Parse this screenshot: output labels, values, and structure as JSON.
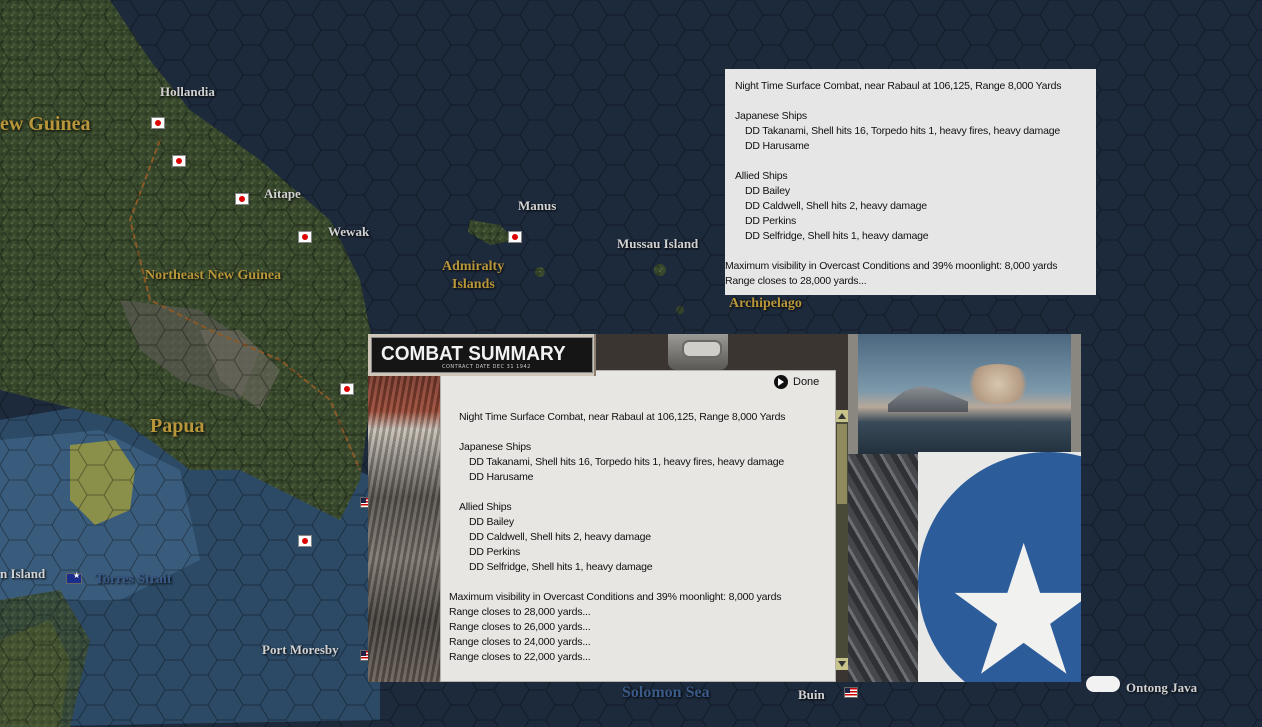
{
  "map": {
    "town_labels": [
      "Hollandia",
      "Aitape",
      "Wewak",
      "Manus",
      "Mussau Island",
      "Port Moresby",
      "Buin",
      "Ontong Java",
      "n Island"
    ],
    "region_labels": [
      "ew Guinea",
      "Northeast New Guinea",
      "Papua",
      "Admiralty",
      "Islands",
      "Archipelago",
      "Torres Strait",
      "Solomon Sea"
    ]
  },
  "tooltip": {
    "title": "Night Time Surface Combat, near Rabaul at 106,125, Range 8,000 Yards",
    "japanese_header": "Japanese Ships",
    "japanese_ships": [
      "DD Takanami, Shell hits 16, Torpedo hits 1,  heavy fires,  heavy damage",
      "DD Harusame"
    ],
    "allied_header": "Allied Ships",
    "allied_ships": [
      "DD Bailey",
      "DD Caldwell, Shell hits 2,  heavy damage",
      "DD Perkins",
      "DD Selfridge, Shell hits 1,  heavy damage"
    ],
    "visibility": "Maximum visibility in Overcast Conditions and 39% moonlight: 8,000 yards",
    "range_lines": [
      "Range closes to 28,000 yards..."
    ]
  },
  "combat": {
    "header_title": "COMBAT SUMMARY",
    "header_sub": "CONTRACT DATE  DEC  31  1942",
    "done_label": "Done",
    "report": {
      "title": "Night Time Surface Combat, near Rabaul at 106,125, Range 8,000 Yards",
      "japanese_header": "Japanese Ships",
      "japanese_ships": [
        "DD Takanami, Shell hits 16, Torpedo hits 1,  heavy fires,  heavy damage",
        "DD Harusame"
      ],
      "allied_header": "Allied Ships",
      "allied_ships": [
        "DD Bailey",
        "DD Caldwell, Shell hits 2,  heavy damage",
        "DD Perkins",
        "DD Selfridge, Shell hits 1,  heavy damage"
      ],
      "visibility": "Maximum visibility in Overcast Conditions and 39% moonlight: 8,000 yards",
      "range_lines": [
        "Range closes to 28,000 yards...",
        "Range closes to 26,000 yards...",
        "Range closes to 24,000 yards...",
        "Range closes to 22,000 yards..."
      ]
    },
    "icons": {
      "done": "arrow-right-circle-icon",
      "scroll_up": "arrow-up-icon",
      "scroll_down": "arrow-down-icon"
    }
  },
  "colors": {
    "ocean": "#1d2a3c",
    "land": "#3b4a2e",
    "region_label": "#b8963a",
    "paper": "#e8e6e3",
    "tooltip_bg": "#e6e6e6"
  }
}
